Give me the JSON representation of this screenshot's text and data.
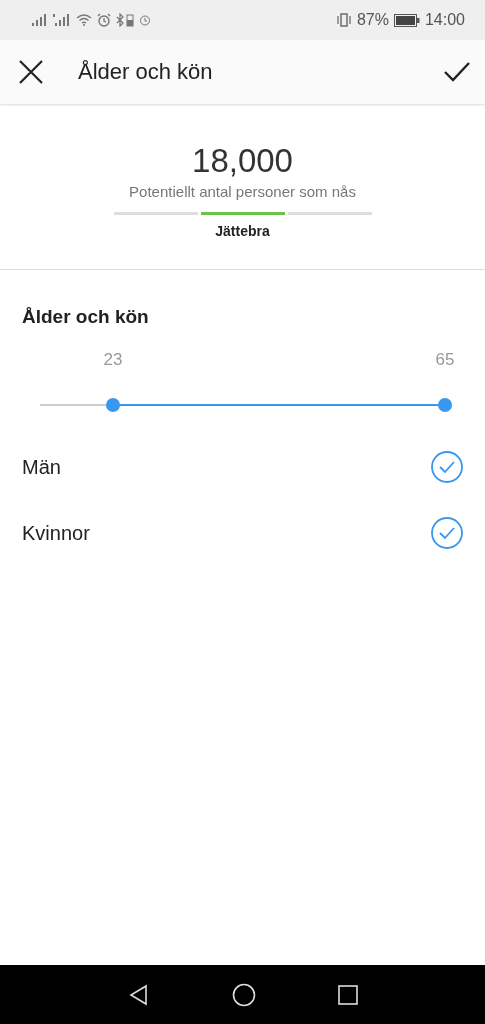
{
  "status_bar": {
    "battery": "87%",
    "time": "14:00"
  },
  "header": {
    "title": "Ålder och kön"
  },
  "reach": {
    "count": "18,000",
    "caption": "Potentiellt antal personer som nås",
    "segments": [
      {
        "selected": false
      },
      {
        "selected": true
      },
      {
        "selected": false
      }
    ],
    "rating": "Jättebra"
  },
  "section": {
    "title": "Ålder och kön",
    "thumbs": [
      {
        "label": "23",
        "level": 0.18
      },
      {
        "label": "65",
        "level": 1
      }
    ]
  },
  "genders": [
    {
      "label": "Män",
      "checked": true
    },
    {
      "label": "Kvinnor",
      "checked": true
    }
  ]
}
